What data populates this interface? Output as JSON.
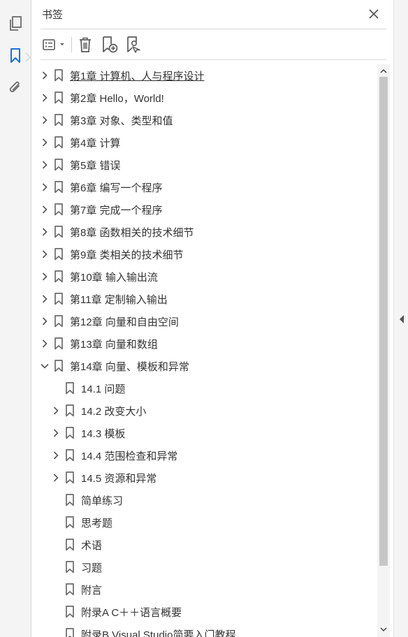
{
  "panel": {
    "title": "书签"
  },
  "left_rail": {
    "items": [
      {
        "icon": "pages-icon"
      },
      {
        "icon": "bookmark-icon",
        "active": true
      },
      {
        "icon": "attachment-icon"
      }
    ]
  },
  "toolbar": {
    "icons": [
      "options-menu-icon",
      "delete-icon",
      "new-bookmark-icon",
      "new-bookmark-from-structure-icon"
    ]
  },
  "bookmarks": [
    {
      "label": "第1章 计算机、人与程序设计",
      "level": 0,
      "expander": "collapsed",
      "underlined": true
    },
    {
      "label": "第2章  Hello，World!",
      "level": 0,
      "expander": "collapsed"
    },
    {
      "label": "第3章  对象、类型和值",
      "level": 0,
      "expander": "collapsed"
    },
    {
      "label": "第4章  计算",
      "level": 0,
      "expander": "collapsed"
    },
    {
      "label": "第5章  错误",
      "level": 0,
      "expander": "collapsed"
    },
    {
      "label": "第6章  编写一个程序",
      "level": 0,
      "expander": "collapsed"
    },
    {
      "label": "第7章  完成一个程序",
      "level": 0,
      "expander": "collapsed"
    },
    {
      "label": "第8章  函数相关的技术细节",
      "level": 0,
      "expander": "collapsed"
    },
    {
      "label": "第9章  类相关的技术细节",
      "level": 0,
      "expander": "collapsed"
    },
    {
      "label": "第10章  输入输出流",
      "level": 0,
      "expander": "collapsed"
    },
    {
      "label": "第11章  定制输入输出",
      "level": 0,
      "expander": "collapsed"
    },
    {
      "label": "第12章  向量和自由空间",
      "level": 0,
      "expander": "collapsed"
    },
    {
      "label": "第13章  向量和数组",
      "level": 0,
      "expander": "collapsed"
    },
    {
      "label": "第14章  向量、模板和异常",
      "level": 0,
      "expander": "expanded"
    },
    {
      "label": "14.1 问题",
      "level": 1,
      "expander": "none"
    },
    {
      "label": "14.2 改变大小",
      "level": 1,
      "expander": "collapsed"
    },
    {
      "label": "14.3 模板",
      "level": 1,
      "expander": "collapsed"
    },
    {
      "label": "14.4 范围检查和异常",
      "level": 1,
      "expander": "collapsed"
    },
    {
      "label": "14.5 资源和异常",
      "level": 1,
      "expander": "collapsed"
    },
    {
      "label": "简单练习",
      "level": 1,
      "expander": "none"
    },
    {
      "label": "思考题",
      "level": 1,
      "expander": "none"
    },
    {
      "label": "术语",
      "level": 1,
      "expander": "none"
    },
    {
      "label": "习题",
      "level": 1,
      "expander": "none"
    },
    {
      "label": "附言",
      "level": 1,
      "expander": "none"
    },
    {
      "label": "附录A  C＋＋语言概要",
      "level": 1,
      "expander": "none"
    },
    {
      "label": "附录B  Visual Studio简要入门教程",
      "level": 1,
      "expander": "none"
    }
  ],
  "colors": {
    "icon": "#6b6b6b",
    "active_icon": "#1473e6",
    "text": "#333333",
    "scroll_thumb": "#c6c6c6"
  }
}
